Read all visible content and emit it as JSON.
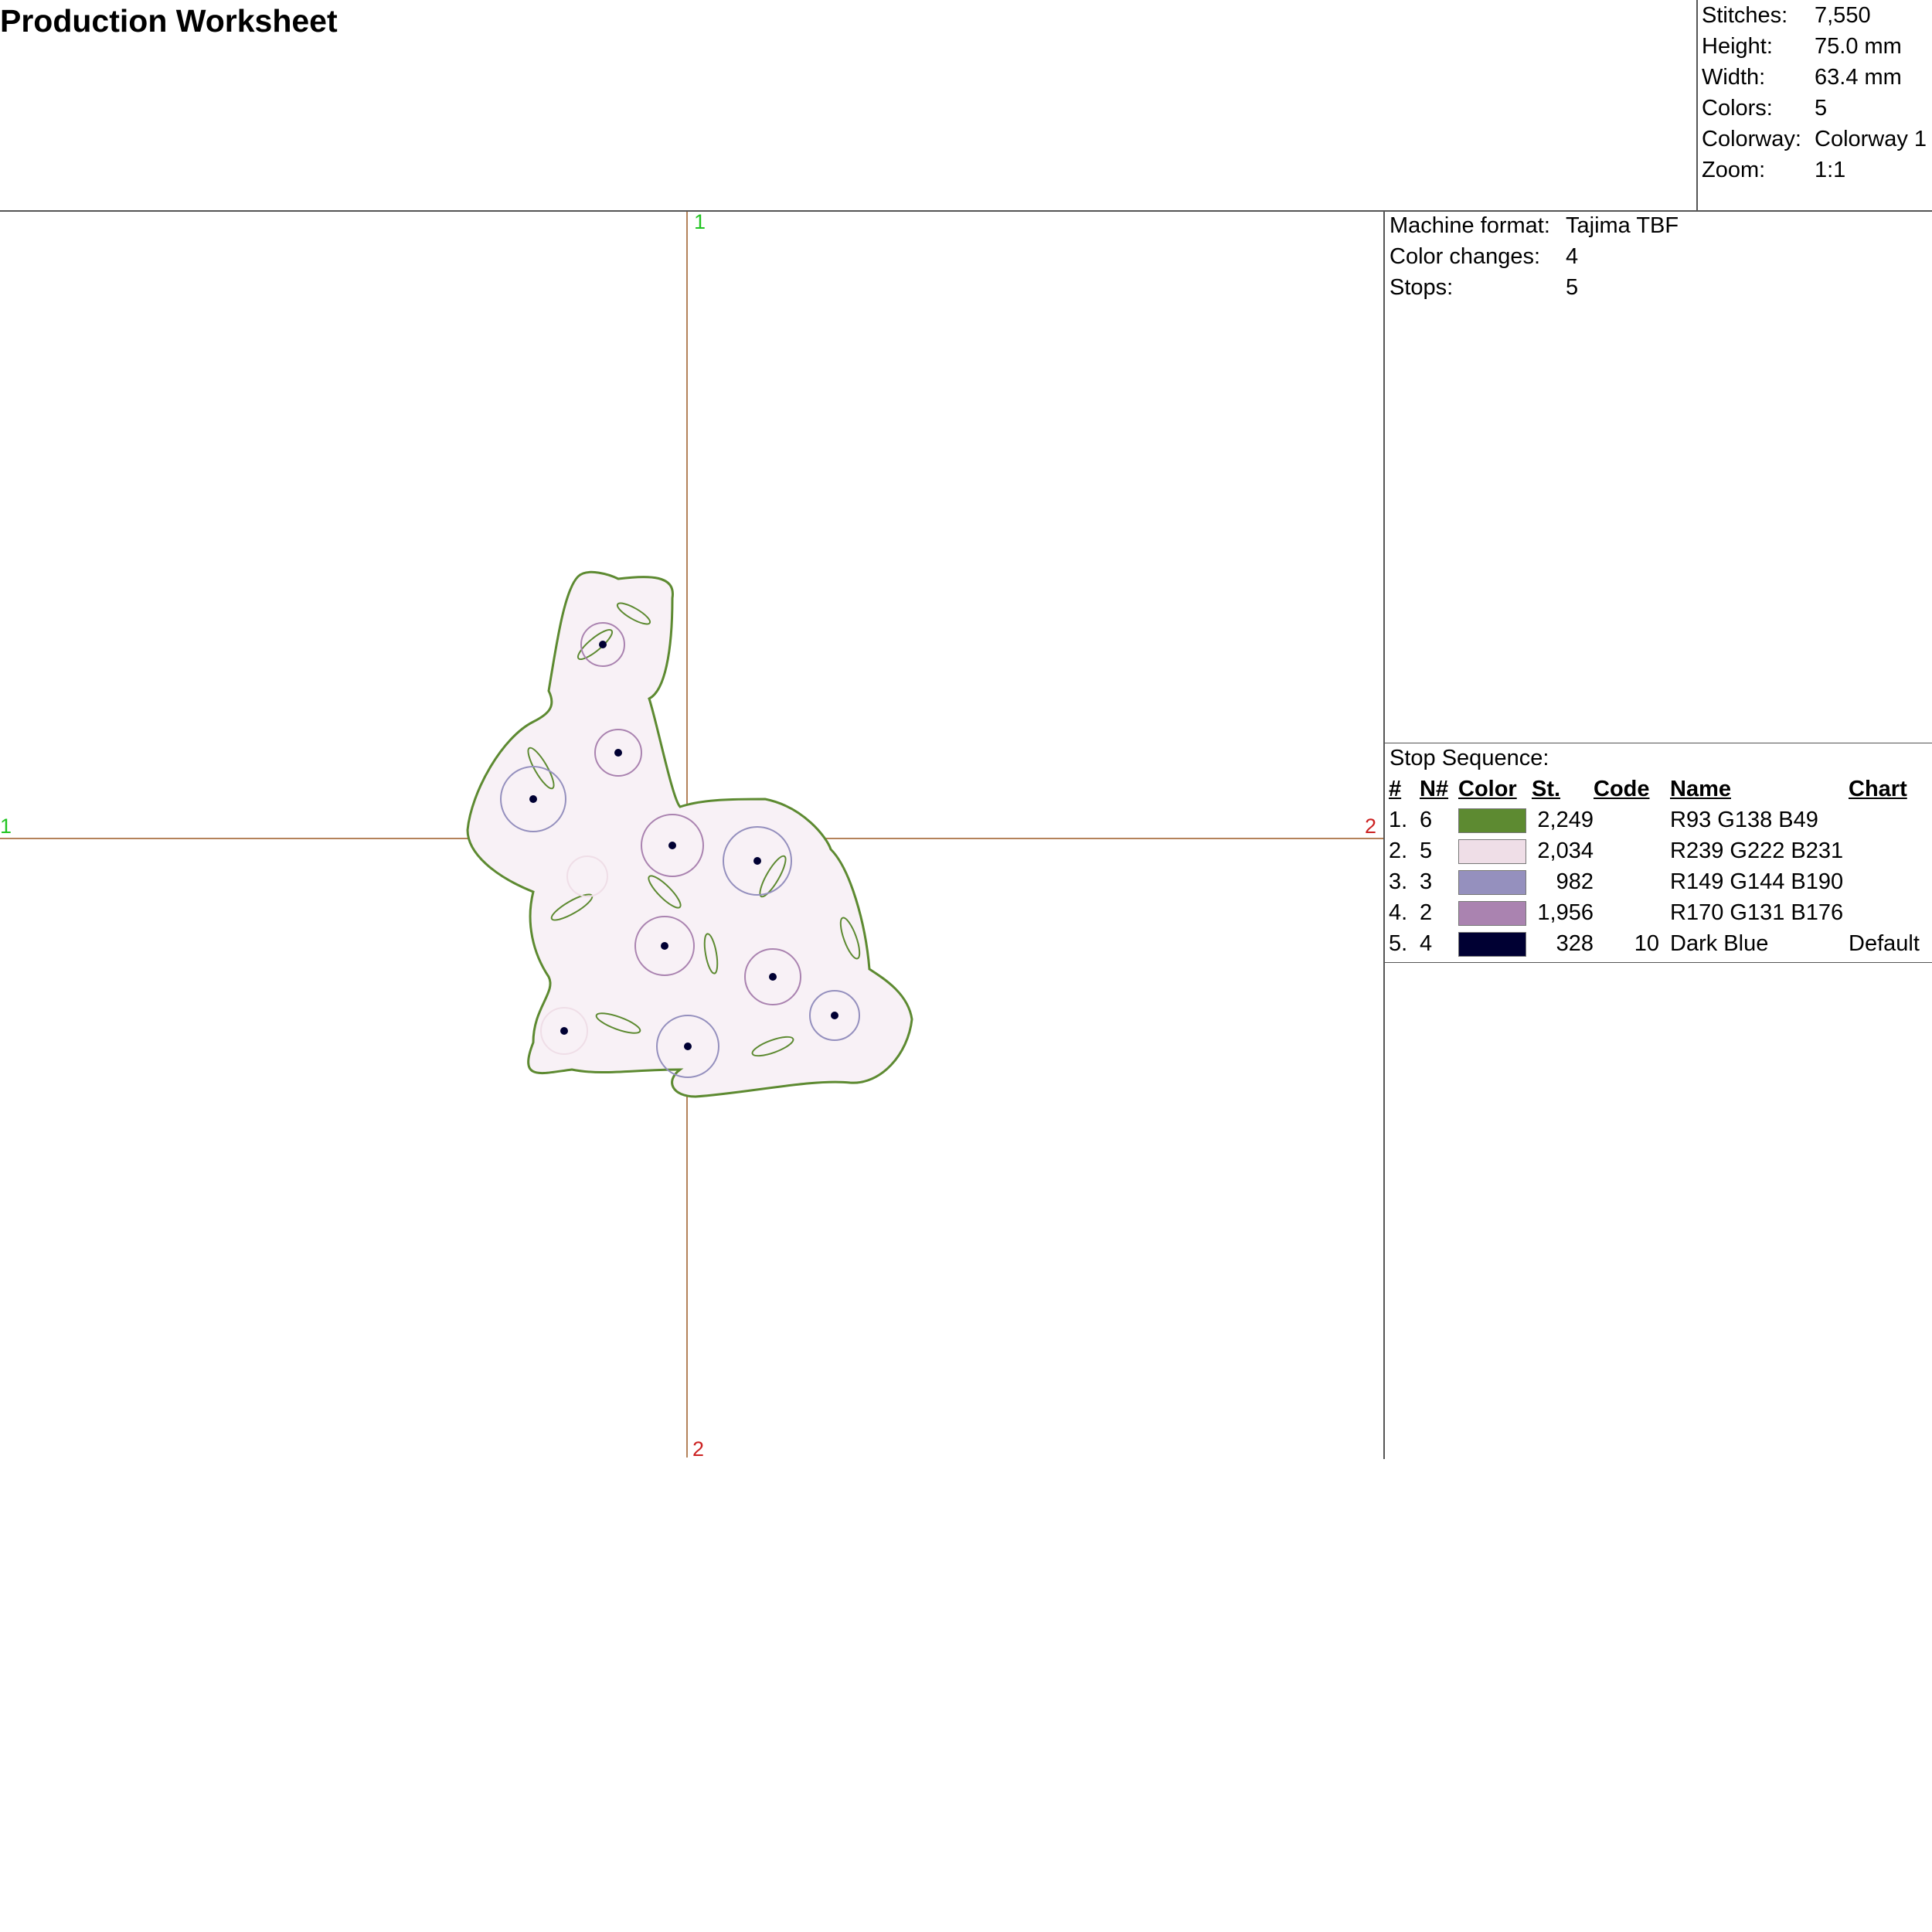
{
  "header": {
    "title": "Production Worksheet"
  },
  "stats": [
    {
      "label": "Stitches:",
      "value": "7,550"
    },
    {
      "label": "Height:",
      "value": "75.0 mm"
    },
    {
      "label": "Width:",
      "value": "63.4 mm"
    },
    {
      "label": "Colors:",
      "value": "5"
    },
    {
      "label": "Colorway:",
      "value": "Colorway 1"
    },
    {
      "label": "Zoom:",
      "value": "1:1"
    }
  ],
  "machine": [
    {
      "label": "Machine format:",
      "value": "Tajima TBF"
    },
    {
      "label": "Color changes:",
      "value": "4"
    },
    {
      "label": "Stops:",
      "value": "5"
    }
  ],
  "axes": {
    "left": "1",
    "right": "2",
    "top": "1",
    "bottom": "2"
  },
  "design": {
    "description_icon": "embroidery-bunny-floral"
  },
  "stop_sequence": {
    "label": "Stop Sequence:",
    "headers": [
      "#",
      "N#",
      "Color",
      "St.",
      "Code",
      "Name",
      "Chart"
    ],
    "rows": [
      {
        "idx": "1.",
        "n": "6",
        "color": "#5D8A31",
        "st": "2,249",
        "code": "",
        "name": "R93 G138 B49",
        "chart": ""
      },
      {
        "idx": "2.",
        "n": "5",
        "color": "#EFDEE7",
        "st": "2,034",
        "code": "",
        "name": "R239 G222 B231",
        "chart": ""
      },
      {
        "idx": "3.",
        "n": "3",
        "color": "#9590BE",
        "st": "982",
        "code": "",
        "name": "R149 G144 B190",
        "chart": ""
      },
      {
        "idx": "4.",
        "n": "2",
        "color": "#AA83B0",
        "st": "1,956",
        "code": "",
        "name": "R170 G131 B176",
        "chart": ""
      },
      {
        "idx": "5.",
        "n": "4",
        "color": "#000033",
        "st": "328",
        "code": "10",
        "name": "Dark Blue",
        "chart": "Default"
      }
    ]
  }
}
